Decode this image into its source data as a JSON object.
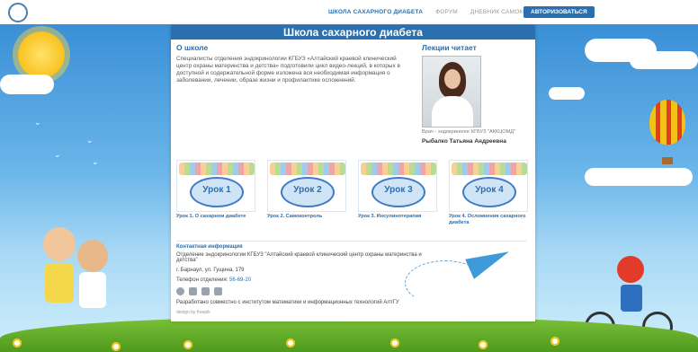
{
  "nav": {
    "items": [
      {
        "label": "ШКОЛА САХАРНОГО ДИАБЕТА",
        "active": true
      },
      {
        "label": "ФОРУМ",
        "active": false
      },
      {
        "label": "ДНЕВНИК САМОКОНТРОЛЯ",
        "active": false
      }
    ],
    "login_label": "АВТОРИЗОВАТЬСЯ"
  },
  "page": {
    "title": "Школа сахарного диабета"
  },
  "about": {
    "heading": "О школе",
    "text": "Специалисты отделения эндокринологии КГБУЗ «Алтайский краевой клинический центр охраны материнства и детства» подготовили цикл видео-лекций, в которых в доступной и содержательной форме изложена вся необходимая информация о заболевании, лечении, образе жизни и профилактике осложнений."
  },
  "lecturer": {
    "heading": "Лекции читает",
    "role": "Врач - эндокринолог КГБУЗ \"АККЦОМД\"",
    "name": "Рыбалко Татьяна Андреевна"
  },
  "lessons": [
    {
      "badge": "Урок 1",
      "caption": "Урок 1. О сахарном диабете"
    },
    {
      "badge": "Урок 2",
      "caption": "Урок 2. Самоконтроль"
    },
    {
      "badge": "Урок 3",
      "caption": "Урок 3. Инсулинотерапия"
    },
    {
      "badge": "Урок 4",
      "caption": "Урок 4. Осложнения сахарного диабета"
    }
  ],
  "contacts": {
    "heading": "Контактная информация",
    "org": "Отделение эндокринологии КГБУЗ \"Алтайский краевой клинический центр охраны материнства и детства\"",
    "address": "г. Барнаул, ул. Гущина, 179",
    "phone_label": "Телефон отделения:",
    "phone": "56-69-20",
    "developed": "Разработано совместно с институтом математики и информационных технологий АлтГУ",
    "credit": "design by freepik"
  },
  "icons": [
    "site-logo-icon",
    "globe-icon",
    "vk-icon",
    "mail-icon",
    "doc-icon"
  ]
}
